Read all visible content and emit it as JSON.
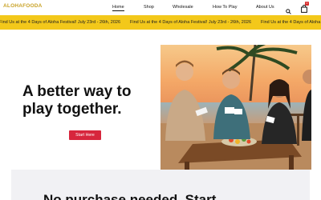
{
  "nav": {
    "logo_text": "ALOHAFOODA",
    "links": [
      "Home",
      "Shop",
      "Wholesale",
      "How To Play",
      "About Us"
    ],
    "cart_count": "0"
  },
  "banner": {
    "message": "Find Us at the 4 Days of Aloha Festival! July 23rd - 26th, 2026"
  },
  "hero": {
    "title_line1": "A better way to",
    "title_line2": "play together.",
    "cta_label": "Start Here"
  },
  "section": {
    "heading_partial": "No purchase needed. Start"
  },
  "colors": {
    "banner_bg": "#f3c81a",
    "cta_bg": "#d7263d",
    "logo": "#c9a227"
  },
  "icons": [
    "search-icon",
    "cart-icon"
  ]
}
